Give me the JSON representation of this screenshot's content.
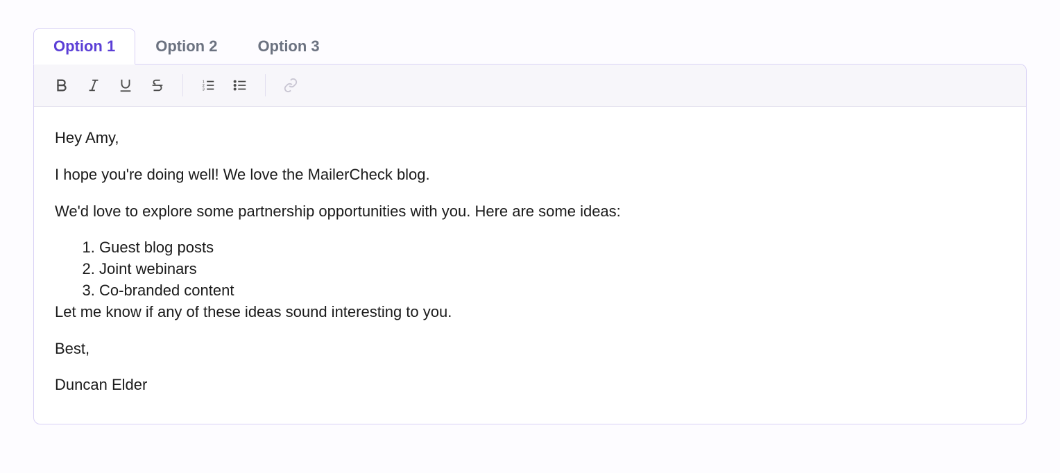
{
  "tabs": [
    {
      "label": "Option 1",
      "active": true
    },
    {
      "label": "Option 2",
      "active": false
    },
    {
      "label": "Option 3",
      "active": false
    }
  ],
  "toolbar": {
    "bold": "bold",
    "italic": "italic",
    "underline": "underline",
    "strike": "strikethrough",
    "ol": "ordered-list",
    "ul": "unordered-list",
    "link": "link"
  },
  "email": {
    "greeting": "Hey Amy,",
    "intro": "I hope you're doing well! We love the MailerCheck blog.",
    "pitch": "We'd love to explore some partnership opportunities with you. Here are some ideas:",
    "ideas": [
      "Guest blog posts",
      "Joint webinars",
      "Co-branded content"
    ],
    "followup": "Let me know if any of these ideas sound interesting to you.",
    "signoff": "Best,",
    "name": "Duncan Elder"
  }
}
